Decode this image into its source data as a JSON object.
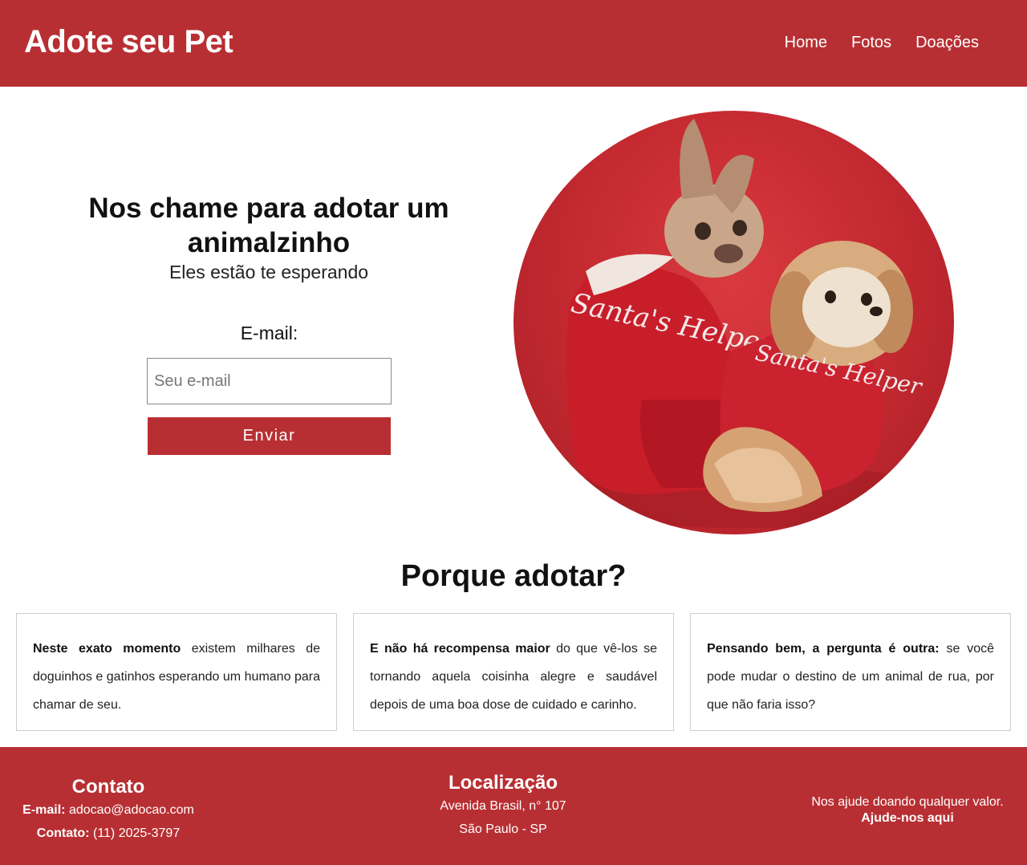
{
  "header": {
    "logo": "Adote seu Pet",
    "nav": [
      "Home",
      "Fotos",
      "Doações"
    ]
  },
  "hero": {
    "title": "Nos chame para adotar um animalzinho",
    "subtitle": "Eles estão te esperando",
    "email_label": "E-mail:",
    "email_placeholder": "Seu e-mail",
    "email_value": "",
    "button_label": "Enviar"
  },
  "photo": {
    "shirt_text_left": "Santa's Helper",
    "shirt_text_right": "Santa's Helper"
  },
  "why": {
    "title": "Porque adotar?",
    "cards": [
      {
        "bold": "Neste exato momento",
        "text": " existem milhares de doguinhos e gatinhos esperando um humano para chamar de seu."
      },
      {
        "bold": "E não há recompensa maior",
        "text": " do que vê-los se tornando aquela coisinha alegre e saudável depois de uma boa dose de cuidado e carinho."
      },
      {
        "bold": "Pensando bem, a pergunta é outra:",
        "text": " se você pode mudar o destino de um animal de rua, por que não faria isso?"
      }
    ]
  },
  "footer": {
    "contact": {
      "title": "Contato",
      "email_label": "E-mail:",
      "email": "adocao@adocao.com",
      "phone_label": "Contato:",
      "phone": "(11) 2025-3797"
    },
    "location": {
      "title": "Localização",
      "address": "Avenida Brasil, n° 107",
      "city": "São Paulo - SP"
    },
    "help": {
      "text": "Nos ajude doando qualquer valor.",
      "link": "Ajude-nos aqui"
    }
  },
  "colors": {
    "brand": "#b82f33",
    "background": "#ffffff"
  }
}
